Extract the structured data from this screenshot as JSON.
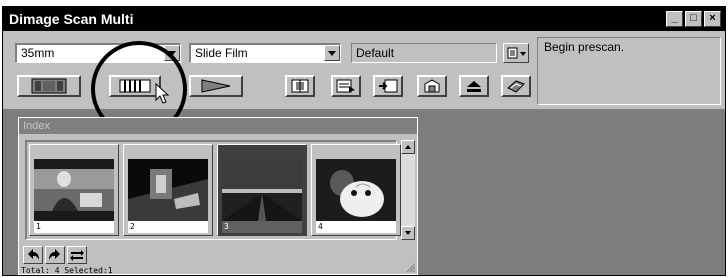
{
  "window": {
    "title": "Dimage Scan Multi",
    "controls": {
      "minimize": "_",
      "maximize": "□",
      "close": "×"
    }
  },
  "toolbar": {
    "film_format": {
      "value": "35mm",
      "icon": "dropdown-arrow-icon"
    },
    "film_type": {
      "value": "Slide Film",
      "icon": "dropdown-arrow-icon"
    },
    "settings_name": {
      "value": "Default"
    },
    "status_message": "Begin prescan.",
    "buttons": [
      {
        "name": "single-frame-prescan",
        "icon": "film-frame-icon"
      },
      {
        "name": "index-scan",
        "icon": "film-strip-icon"
      },
      {
        "name": "scan",
        "icon": "play-triangle-icon"
      },
      {
        "name": "crop",
        "icon": "crop-icon"
      },
      {
        "name": "image-correction",
        "icon": "image-correction-icon"
      },
      {
        "name": "scan-to-file",
        "icon": "scan-arrow-icon"
      },
      {
        "name": "preferences",
        "icon": "preferences-icon"
      },
      {
        "name": "eject",
        "icon": "eject-icon"
      },
      {
        "name": "help",
        "icon": "help-book-icon"
      }
    ]
  },
  "index": {
    "title": "Index",
    "thumbnails": [
      {
        "number": "1",
        "selected": false
      },
      {
        "number": "2",
        "selected": false
      },
      {
        "number": "3",
        "selected": true
      },
      {
        "number": "4",
        "selected": false
      }
    ],
    "status_text": "Total: 4  Selected:1",
    "bottom_buttons": [
      "rotate-left-icon",
      "rotate-right-icon",
      "flip-icon"
    ]
  },
  "colors": {
    "titlebar": "#000000",
    "window_bg": "#c0c0c0",
    "workspace": "#7d7d7d"
  }
}
